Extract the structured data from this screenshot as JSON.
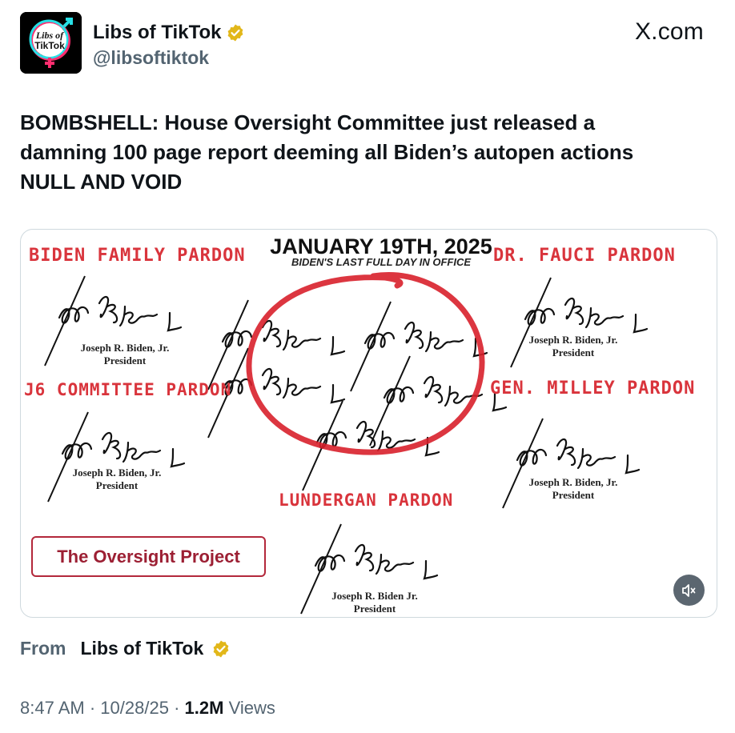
{
  "header": {
    "display_name": "Libs of TikTok",
    "handle": "@libsoftiktok",
    "site": "X.com",
    "avatar_text": "Libs of TikTok"
  },
  "tweet": {
    "text_lines": [
      "BOMBSHELL: House Oversight Committee just released a",
      "damning 100 page report deeming all Biden’s autopen actions",
      "NULL AND VOID"
    ]
  },
  "media": {
    "title": "JANUARY 19TH, 2025",
    "subtitle": "BIDEN'S LAST FULL DAY IN OFFICE",
    "labels": {
      "biden_family": "BIDEN FAMILY PARDON",
      "fauci": "DR. FAUCI PARDON",
      "j6": "J6 COMMITTEE PARDON",
      "milley": "GEN. MILLEY PARDON",
      "lonergan": "LUNDERGAN PARDON"
    },
    "signature_name": "Joseph R. Biden, Jr.",
    "signature_name_alt": "Joseph R. Biden Jr.",
    "signature_title": "President",
    "brand_box": "The Oversight Project"
  },
  "footer": {
    "from_label": "From",
    "from_name": "Libs of TikTok",
    "time": "8:47 AM",
    "date": "10/28/25",
    "views_count": "1.2M",
    "views_label": "Views",
    "separator": "·"
  },
  "colors": {
    "verified_gold": "#e2b719",
    "label_red": "#d9343c",
    "circle_red": "#d8202b",
    "brand_maroon": "#9c1f33",
    "muted_text": "#536471"
  }
}
